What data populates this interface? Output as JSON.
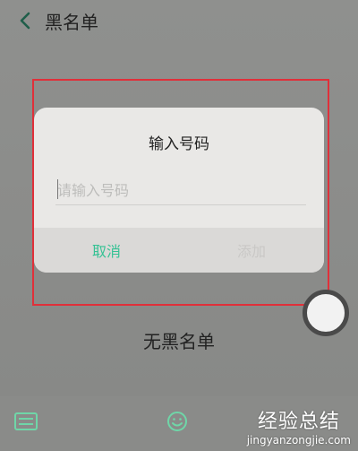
{
  "header": {
    "title": "黑名单",
    "back_icon": "chevron-left-icon"
  },
  "dialog": {
    "title": "输入号码",
    "input_placeholder": "请输入号码",
    "input_value": "",
    "cancel_label": "取消",
    "add_label": "添加"
  },
  "main": {
    "empty_text": "无黑名单"
  },
  "toolbar": {
    "keyboard_icon": "keyboard-icon",
    "emoji_icon": "smile-icon"
  },
  "watermark": {
    "title": "经验总结",
    "subtitle": "jingyanzongjie.com"
  },
  "colors": {
    "accent": "#35c294",
    "highlight_frame": "#e0303a",
    "disabled_text": "#c9c8c6"
  }
}
